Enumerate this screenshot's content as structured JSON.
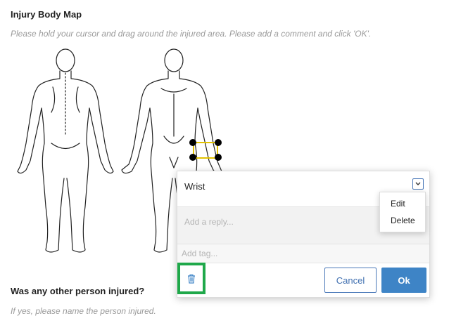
{
  "title": "Injury Body Map",
  "instructions": "Please hold your cursor and drag around the injured area. Please add a comment and click 'OK'.",
  "popup": {
    "comment": "Wrist",
    "reply_placeholder": "Add a reply...",
    "tag_placeholder": "Add tag...",
    "cancel_label": "Cancel",
    "ok_label": "Ok",
    "trash_icon": "trash-icon",
    "menu_icon": "chevron-down-icon"
  },
  "menu": {
    "items": [
      "Edit",
      "Delete"
    ]
  },
  "question": {
    "label": "Was any other person injured?",
    "hint": "If yes, please name the person injured."
  },
  "colors": {
    "highlight": "#1fa84a",
    "selection": "#e2c200",
    "primary": "#3e84c6"
  }
}
